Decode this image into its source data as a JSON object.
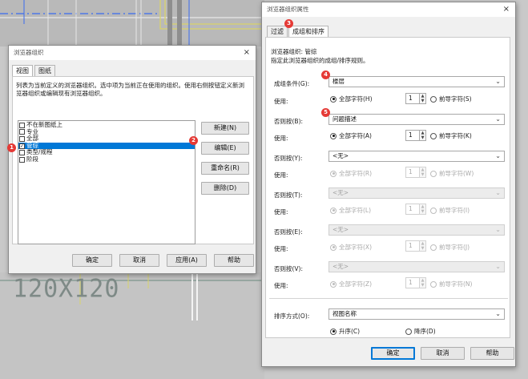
{
  "background": {
    "cad_label": "120X120"
  },
  "org_dialog": {
    "title": "浏览器组织",
    "close": "×",
    "tabs": [
      {
        "label": "视图"
      },
      {
        "label": "图纸"
      }
    ],
    "description": "列表为当前定义的浏览器组织。选中项为当前正在使用的组织。使用右侧按钮定义新浏览器组织或编辑现有浏览器组织。",
    "items": [
      {
        "label": "不在新图纸上",
        "checked": false
      },
      {
        "label": "专业",
        "checked": false
      },
      {
        "label": "全部",
        "checked": false
      },
      {
        "label": "管综",
        "checked": true
      },
      {
        "label": "类型/规程",
        "checked": false
      },
      {
        "label": "阶段",
        "checked": false
      }
    ],
    "side_buttons": {
      "new": "新建(N)",
      "edit": "编辑(E)",
      "rename": "重命名(R)",
      "delete": "删除(D)"
    },
    "footer": {
      "ok": "确定",
      "cancel": "取消",
      "apply": "应用(A)",
      "help": "帮助"
    }
  },
  "props_dialog": {
    "title": "浏览器组织属性",
    "close": "×",
    "tabs": [
      {
        "label": "过滤"
      },
      {
        "label": "成组和排序"
      }
    ],
    "org_name": "浏览器组织: 管综",
    "instruction": "指定此浏览器组织的成组/排序规则。",
    "rows": [
      {
        "label": "成组条件(G):",
        "value": "楼层",
        "use": "使用:",
        "all": "全部字符(H)",
        "lead": "前导字符(S)",
        "count": "1"
      },
      {
        "label": "否则按(B):",
        "value": "问题描述",
        "use": "使用:",
        "all": "全部字符(A)",
        "lead": "前导字符(K)",
        "count": "1"
      },
      {
        "label": "否则按(Y):",
        "value": "<无>",
        "use": "使用:",
        "all": "全部字符(R)",
        "lead": "前导字符(W)",
        "count": "1"
      },
      {
        "label": "否则按(T):",
        "value": "<无>",
        "use": "使用:",
        "all": "全部字符(L)",
        "lead": "前导字符(I)",
        "count": "1"
      },
      {
        "label": "否则按(E):",
        "value": "<无>",
        "use": "使用:",
        "all": "全部字符(X)",
        "lead": "前导字符(J)",
        "count": "1"
      },
      {
        "label": "否则按(V):",
        "value": "<无>",
        "use": "使用:",
        "all": "全部字符(Z)",
        "lead": "前导字符(N)",
        "count": "1"
      }
    ],
    "sort_label": "排序方式(O):",
    "sort_value": "视图名称",
    "asc": "升序(C)",
    "desc": "降序(D)",
    "footer": {
      "ok": "确定",
      "cancel": "取消",
      "help": "帮助"
    }
  },
  "badges": [
    "1",
    "2",
    "3",
    "4",
    "5"
  ],
  "colors": {
    "accent": "#0078d7",
    "badge": "#e53935"
  }
}
